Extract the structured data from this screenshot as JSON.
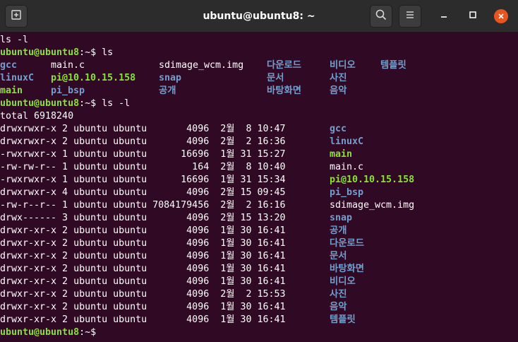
{
  "window": {
    "title": "ubuntu@ubuntu8: ~"
  },
  "colors": {
    "background": "#300a24",
    "titlebar": "#2c2c2c",
    "prompt": "#8ae234",
    "directory": "#729fcf",
    "executable": "#8ae234",
    "close": "#e95420"
  },
  "icons": [
    "new-tab-icon",
    "search-icon",
    "hamburger-menu-icon",
    "minimize-icon",
    "maximize-icon",
    "close-icon"
  ],
  "terminal": {
    "line0": "ls -l",
    "prompt1": {
      "user": "ubuntu@ubuntu8",
      "sep": ":~$ ",
      "cmd": "ls"
    },
    "ls_rows": [
      [
        "gcc",
        "main.c",
        "sdimage_wcm.img",
        "다운로드",
        "비디오",
        "템플릿"
      ],
      [
        "linuxC",
        "pi@10.10.15.158",
        "snap",
        "문서",
        "사진",
        ""
      ],
      [
        "main",
        "pi_bsp",
        "공개",
        "바탕화면",
        "음악",
        ""
      ]
    ],
    "prompt2": {
      "user": "ubuntu@ubuntu8",
      "sep": ":~$ ",
      "cmd": "ls -l"
    },
    "total": "total 6918240",
    "listing": [
      {
        "meta": "drwxrwxr-x 2 ubuntu ubuntu       4096  2월  8 10:47 ",
        "name": "gcc",
        "kind": "dir"
      },
      {
        "meta": "drwxrwxr-x 2 ubuntu ubuntu       4096  2월  2 16:36 ",
        "name": "linuxC",
        "kind": "dir"
      },
      {
        "meta": "-rwxrwxr-x 1 ubuntu ubuntu      16696  1월 31 15:27 ",
        "name": "main",
        "kind": "exec"
      },
      {
        "meta": "-rw-rw-r-- 1 ubuntu ubuntu        164  2월  8 10:40 ",
        "name": "main.c",
        "kind": "file"
      },
      {
        "meta": "-rwxrwxr-x 1 ubuntu ubuntu      16696  1월 31 15:34 ",
        "name": "pi@10.10.15.158",
        "kind": "exec"
      },
      {
        "meta": "drwxrwxr-x 4 ubuntu ubuntu       4096  2월 15 09:45 ",
        "name": "pi_bsp",
        "kind": "dir"
      },
      {
        "meta": "-rw-r--r-- 1 ubuntu ubuntu 7084179456  2월  2 16:16 ",
        "name": "sdimage_wcm.img",
        "kind": "file"
      },
      {
        "meta": "drwx------ 3 ubuntu ubuntu       4096  2월 15 13:20 ",
        "name": "snap",
        "kind": "dir"
      },
      {
        "meta": "drwxr-xr-x 2 ubuntu ubuntu       4096  1월 30 16:41 ",
        "name": "공개",
        "kind": "dir"
      },
      {
        "meta": "drwxr-xr-x 2 ubuntu ubuntu       4096  1월 30 16:41 ",
        "name": "다운로드",
        "kind": "dir"
      },
      {
        "meta": "drwxr-xr-x 2 ubuntu ubuntu       4096  1월 30 16:41 ",
        "name": "문서",
        "kind": "dir"
      },
      {
        "meta": "drwxr-xr-x 2 ubuntu ubuntu       4096  1월 30 16:41 ",
        "name": "바탕화면",
        "kind": "dir"
      },
      {
        "meta": "drwxr-xr-x 2 ubuntu ubuntu       4096  1월 30 16:41 ",
        "name": "비디오",
        "kind": "dir"
      },
      {
        "meta": "drwxr-xr-x 2 ubuntu ubuntu       4096  2월  2 15:53 ",
        "name": "사진",
        "kind": "dir"
      },
      {
        "meta": "drwxr-xr-x 2 ubuntu ubuntu       4096  1월 30 16:41 ",
        "name": "음악",
        "kind": "dir"
      },
      {
        "meta": "drwxr-xr-x 2 ubuntu ubuntu       4096  1월 30 16:41 ",
        "name": "템플릿",
        "kind": "dir"
      }
    ],
    "prompt3": {
      "user": "ubuntu@ubuntu8",
      "sep": ":~$ ",
      "cmd": ""
    }
  }
}
